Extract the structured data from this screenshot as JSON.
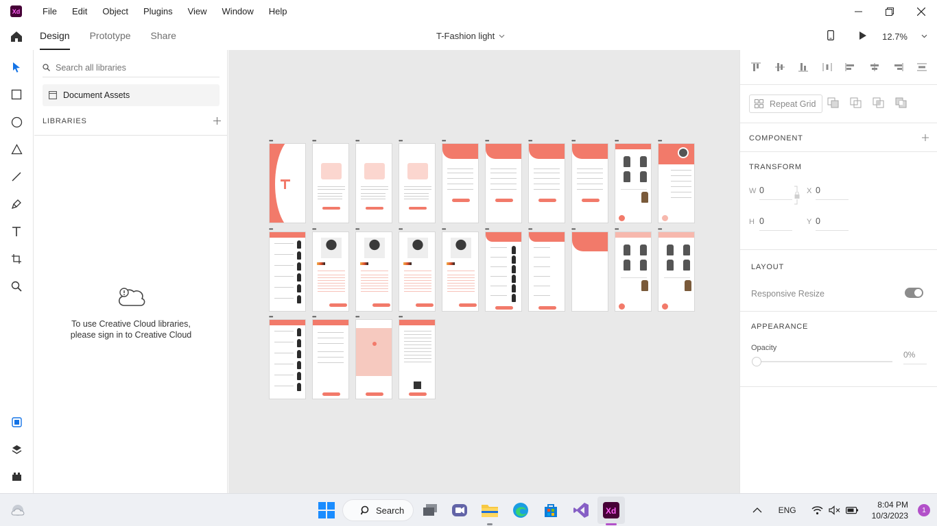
{
  "app": {
    "logo_text": "Xd"
  },
  "menu": {
    "items": [
      "File",
      "Edit",
      "Object",
      "Plugins",
      "View",
      "Window",
      "Help"
    ]
  },
  "toolbar": {
    "tabs": [
      "Design",
      "Prototype",
      "Share"
    ],
    "active_tab": "Design",
    "document_title": "T-Fashion light",
    "zoom": "12.7%"
  },
  "library": {
    "search_placeholder": "Search all libraries",
    "document_assets": "Document Assets",
    "libraries_heading": "LIBRARIES",
    "cc_message_line1": "To use Creative Cloud libraries,",
    "cc_message_line2": "please sign in to Creative Cloud"
  },
  "properties": {
    "repeat_grid": "Repeat Grid",
    "component_heading": "COMPONENT",
    "transform_heading": "TRANSFORM",
    "w_label": "W",
    "w_value": "0",
    "h_label": "H",
    "h_value": "0",
    "x_label": "X",
    "x_value": "0",
    "y_label": "Y",
    "y_value": "0",
    "layout_heading": "LAYOUT",
    "responsive_resize": "Responsive Resize",
    "responsive_resize_on": true,
    "appearance_heading": "APPEARANCE",
    "opacity_label": "Opacity",
    "opacity_value": "0%"
  },
  "taskbar": {
    "search_label": "Search",
    "language": "ENG",
    "time": "8:04 PM",
    "date": "10/3/2023",
    "notification_count": "1"
  },
  "colors": {
    "accent": "#f27a6a",
    "xd_brand": "#470137",
    "xd_pink": "#ff61f6"
  }
}
